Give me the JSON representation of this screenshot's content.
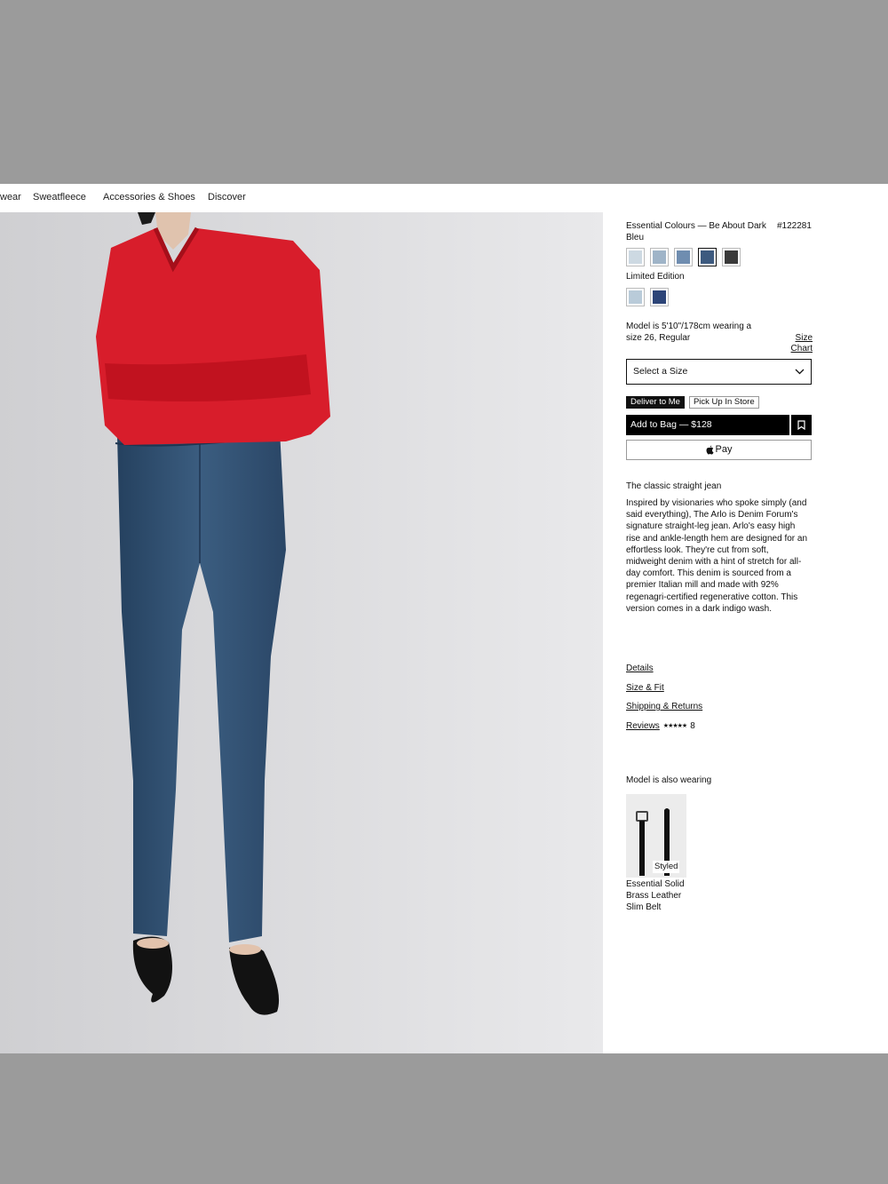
{
  "nav": {
    "items": [
      "wear",
      "Sweatfleece",
      "Accessories & Shoes",
      "Discover"
    ]
  },
  "product": {
    "title": "Essential Colours — Be About Dark Bleu",
    "sku": "#122281",
    "colour_swatches": [
      "#cdd9e2",
      "#9fb4c8",
      "#6f8db0",
      "#3d5a7f",
      "#3a3a3a"
    ],
    "limited_edition_label": "Limited Edition",
    "limited_swatches": [
      "#b9cbd9",
      "#2d4578"
    ],
    "model_info": "Model is 5'10\"/178cm wearing a size 26, Regular",
    "size_chart_label": "Size Chart",
    "size_select_label": "Select a Size",
    "deliver_label": "Deliver to Me",
    "pickup_label": "Pick Up In Store",
    "add_to_bag_label": "Add to Bag — $128",
    "apple_pay_label": "Pay",
    "description_title": "The classic straight jean",
    "description": "Inspired by visionaries who spoke simply (and said everything), The Arlo is Denim Forum's signature straight-leg jean. Arlo's easy high rise and ankle-length hem are designed for an effortless look. They're cut from soft, midweight denim with a hint of stretch for all-day comfort. This denim is sourced from a premier Italian mill and made with 92% regenagri-certified regenerative cotton. This version comes in a dark indigo wash.",
    "details_label": "Details",
    "size_fit_label": "Size & Fit",
    "shipping_label": "Shipping & Returns",
    "reviews_label": "Reviews",
    "stars": "★★★★★",
    "review_count": "8",
    "also_wearing_label": "Model is also wearing",
    "styled_label": "Styled",
    "belt_name": "Essential Solid Brass Leather Slim Belt"
  }
}
